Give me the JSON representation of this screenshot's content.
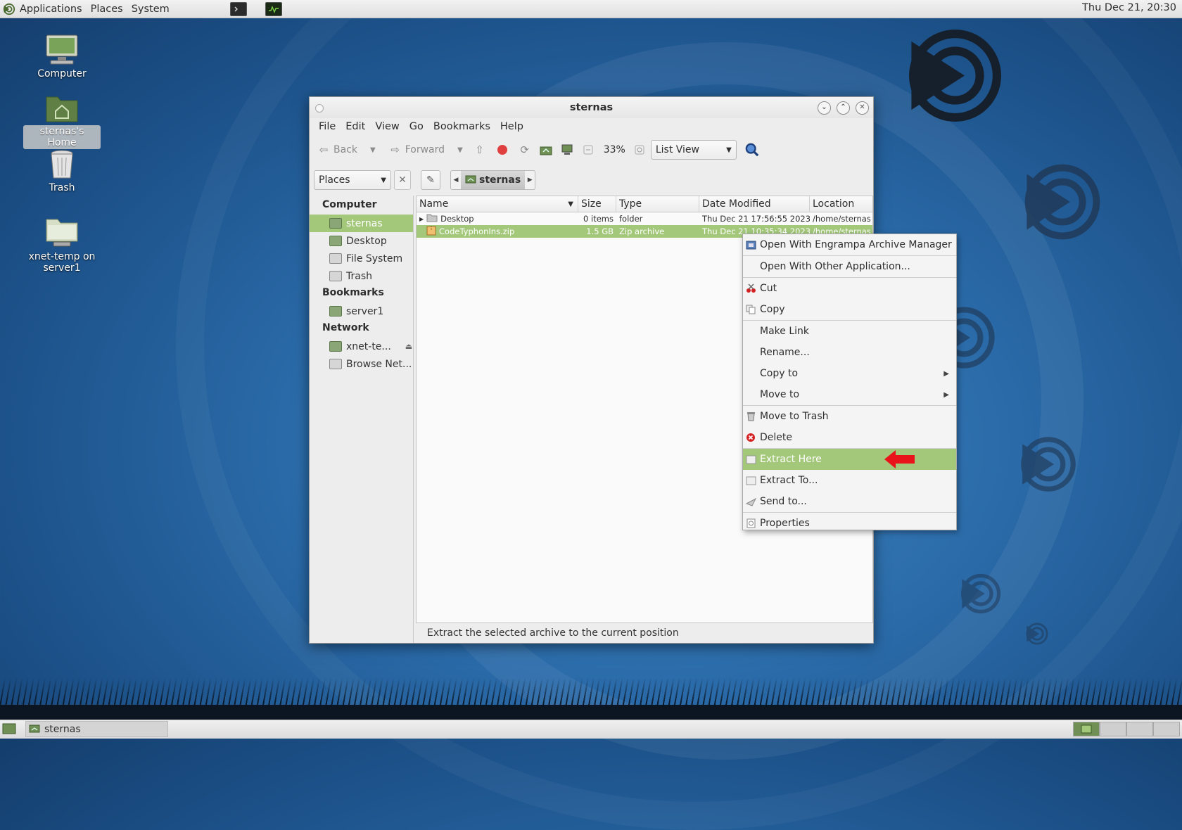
{
  "top_panel": {
    "menus": [
      "Applications",
      "Places",
      "System"
    ],
    "clock": "Thu Dec 21, 20:30"
  },
  "desktop": {
    "icons": [
      {
        "label": "Computer"
      },
      {
        "label": "sternas's Home"
      },
      {
        "label": "Trash"
      },
      {
        "label": "xnet-temp on server1"
      }
    ]
  },
  "window": {
    "title": "sternas",
    "menubar": [
      "File",
      "Edit",
      "View",
      "Go",
      "Bookmarks",
      "Help"
    ],
    "toolbar": {
      "back": "Back",
      "forward": "Forward",
      "zoom": "33%",
      "view_mode": "List View"
    },
    "location": {
      "side_pane_mode": "Places",
      "breadcrumb": "sternas"
    },
    "sidebar": {
      "sections": [
        {
          "heading": "Computer",
          "items": [
            "sternas",
            "Desktop",
            "File System",
            "Trash"
          ]
        },
        {
          "heading": "Bookmarks",
          "items": [
            "server1"
          ]
        },
        {
          "heading": "Network",
          "items": [
            "xnet-te...",
            "Browse Net..."
          ]
        }
      ]
    },
    "columns": [
      "Name",
      "Size",
      "Type",
      "Date Modified",
      "Location"
    ],
    "rows": [
      {
        "name": "Desktop",
        "size": "0 items",
        "type": "folder",
        "date": "Thu Dec 21 17:56:55 2023",
        "location": "/home/sternas"
      },
      {
        "name": "CodeTyphonIns.zip",
        "size": "1.5 GB",
        "type": "Zip archive",
        "date": "Thu Dec 21 10:35:34 2023",
        "location": "/home/sternas"
      }
    ],
    "status": "Extract the selected archive to the current position"
  },
  "context_menu": {
    "items": [
      "Open With Engrampa Archive Manager",
      "Open With Other Application...",
      "Cut",
      "Copy",
      "Make Link",
      "Rename...",
      "Copy to",
      "Move to",
      "Move to Trash",
      "Delete",
      "Extract Here",
      "Extract To...",
      "Send to...",
      "Properties"
    ],
    "highlighted": "Extract Here"
  },
  "bottom_panel": {
    "task": "sternas"
  },
  "colors": {
    "selection": "#a3c87a",
    "arrow": "#e8141a"
  }
}
